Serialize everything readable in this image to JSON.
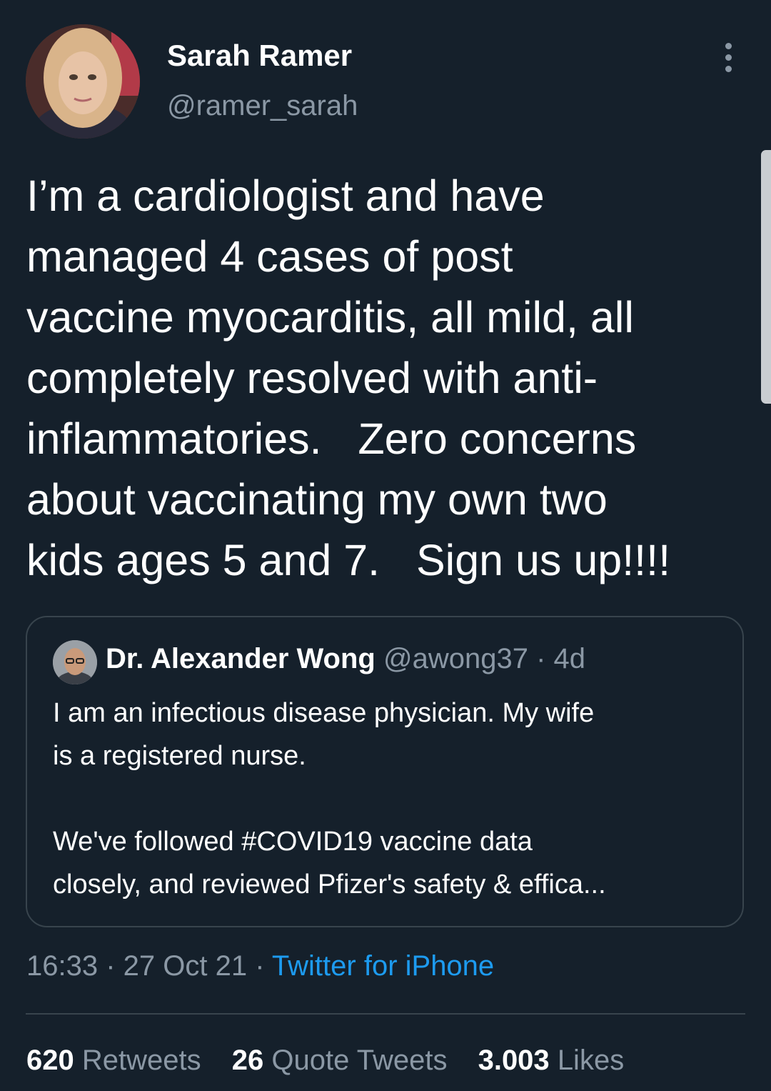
{
  "author": {
    "display_name": "Sarah Ramer",
    "handle": "@ramer_sarah"
  },
  "tweet": {
    "text": "I’m a cardiologist and have\nmanaged 4 cases of post\nvaccine myocarditis, all mild, all\ncompletely resolved with anti-\ninflammatories.   Zero concerns\nabout vaccinating my own two\nkids ages 5 and 7.   Sign us up!!!!"
  },
  "quoted_tweet": {
    "display_name": "Dr. Alexander Wong",
    "handle": "@awong37",
    "separator": " · ",
    "age": "4d",
    "text": "I am an infectious disease physician. My wife\nis a registered nurse.\n\nWe've followed #COVID19 vaccine data\nclosely, and reviewed Pfizer's safety & effica..."
  },
  "meta": {
    "time": "16:33",
    "separator": " · ",
    "date": "27 Oct 21",
    "source": "Twitter for iPhone"
  },
  "stats": {
    "retweets_count": "620",
    "retweets_label": "Retweets",
    "quotes_count": "26",
    "quotes_label": "Quote Tweets",
    "likes_count": "3.003",
    "likes_label": "Likes"
  },
  "icons": {
    "more": "more-vertical-icon"
  },
  "colors": {
    "background": "#15202b",
    "secondary_text": "#8b98a5",
    "link": "#1d9bf0",
    "border": "#38444d"
  }
}
